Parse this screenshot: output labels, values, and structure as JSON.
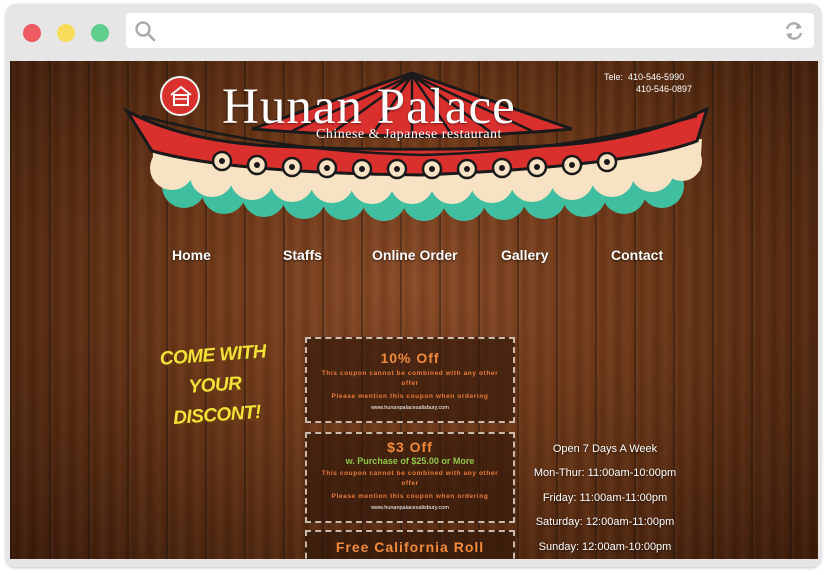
{
  "browser": {
    "url": "",
    "icons": {
      "search": "search-icon",
      "reload": "reload-icon"
    },
    "window_controls": [
      "close",
      "minimize",
      "maximize"
    ]
  },
  "header": {
    "tel_label": "Tele:",
    "phones": [
      "410-546-5990",
      "410-546-0897"
    ],
    "title": "Hunan Palace",
    "tagline": "Chinese & Japanese restaurant",
    "logo_icon": "house-icon"
  },
  "nav": {
    "items": [
      {
        "label": "Home"
      },
      {
        "label": "Staffs"
      },
      {
        "label": "Online Order"
      },
      {
        "label": "Gallery"
      },
      {
        "label": "Contact"
      }
    ]
  },
  "promo": {
    "lines": [
      "COME WITH",
      "YOUR",
      "DISCONT!"
    ]
  },
  "coupons": [
    {
      "title": "10% Off",
      "terms": "This coupon cannot be combined with any other offer",
      "mention": "Please mention this coupon when ordering",
      "url": "www.hunanpalacesalisbury.com"
    },
    {
      "title": "$3 Off",
      "subtitle": "w. Purchase of $25.00 or More",
      "terms": "This coupon cannot be combined with any other offer",
      "mention": "Please mention this coupon when ordering",
      "url": "www.hunanpalacesalisbury.com"
    },
    {
      "title": "Free California Roll"
    }
  ],
  "hours": {
    "heading": "Open 7 Days A Week",
    "lines": [
      "Mon-Thur: 11:00am-10:00pm",
      "Friday: 11:00am-11:00pm",
      "Saturday: 12:00am-11:00pm",
      "Sunday: 12:00am-10:00pm"
    ]
  },
  "colors": {
    "accent_red": "#d9302e",
    "scallop_cream": "#f7e3c3",
    "scallop_teal": "#3fbf9f",
    "coupon_title": "#f28a3c",
    "coupon_subtitle": "#8fc64a",
    "promo_yellow": "#f2e23a"
  }
}
